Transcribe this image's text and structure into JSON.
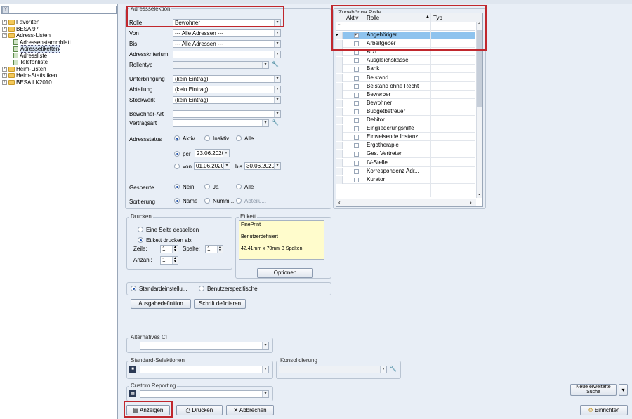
{
  "tree": {
    "filter_value": "",
    "items": [
      {
        "label": "Favoriten",
        "level": 0,
        "type": "folder",
        "expanded": false
      },
      {
        "label": "BESA 97",
        "level": 0,
        "type": "folder",
        "expanded": false
      },
      {
        "label": "Adress-Listen",
        "level": 0,
        "type": "folder",
        "expanded": true
      },
      {
        "label": "Adressenstammblatt",
        "level": 1,
        "type": "doc"
      },
      {
        "label": "Adressetiketten",
        "level": 1,
        "type": "doc",
        "selected": true
      },
      {
        "label": "Adressliste",
        "level": 1,
        "type": "doc"
      },
      {
        "label": "Telefonliste",
        "level": 1,
        "type": "doc"
      },
      {
        "label": "Heim-Listen",
        "level": 0,
        "type": "folder",
        "expanded": false
      },
      {
        "label": "Heim-Statistiken",
        "level": 0,
        "type": "folder",
        "expanded": false
      },
      {
        "label": "BESA LK2010",
        "level": 0,
        "type": "folder",
        "expanded": false
      }
    ]
  },
  "adressselektion": {
    "title": "Adressselektion",
    "rolle_label": "Rolle",
    "rolle_value": "Bewohner",
    "von_label": "Von",
    "von_value": "--- Alle Adressen ---",
    "bis_label": "Bis",
    "bis_value": "--- Alle Adressen ---",
    "kriterium_label": "Adresskriterium",
    "kriterium_value": "",
    "rollentyp_label": "Rollentyp",
    "rollentyp_value": "",
    "unterbringung_label": "Unterbringung",
    "unterbringung_value": "(kein Eintrag)",
    "abteilung_label": "Abteilung",
    "abteilung_value": "(kein Eintrag)",
    "stockwerk_label": "Stockwerk",
    "stockwerk_value": "(kein Eintrag)",
    "bewohnerart_label": "Bewohner-Art",
    "bewohnerart_value": "",
    "vertragsart_label": "Vertragsart",
    "vertragsart_value": "",
    "status_label": "Adressstatus",
    "status_aktiv": "Aktiv",
    "status_inaktiv": "Inaktiv",
    "status_alle": "Alle",
    "per_label": "per",
    "per_date": "23.06.2020",
    "von2_label": "von",
    "von2_date": "01.06.2020",
    "bis2_label": "bis",
    "bis2_date": "30.06.2020",
    "gesperrte_label": "Gesperrte",
    "gesperrte_nein": "Nein",
    "gesperrte_ja": "Ja",
    "gesperrte_alle": "Alle",
    "sortierung_label": "Sortierung",
    "sort_name": "Name",
    "sort_numm": "Numm...",
    "sort_abteilu": "Abteilu..."
  },
  "rollen": {
    "title": "Zugehörige Rolle",
    "col_aktiv": "Aktiv",
    "col_rolle": "Rolle",
    "col_typ": "Typ",
    "rows": [
      {
        "label": "Angehöriger",
        "checked": true,
        "selected": true
      },
      {
        "label": "Arbeitgeber",
        "checked": false
      },
      {
        "label": "Arzt",
        "checked": false
      },
      {
        "label": "Ausgleichskasse",
        "checked": false
      },
      {
        "label": "Bank",
        "checked": false
      },
      {
        "label": "Beistand",
        "checked": false
      },
      {
        "label": "Beistand ohne Recht",
        "checked": false
      },
      {
        "label": "Bewerber",
        "checked": false
      },
      {
        "label": "Bewohner",
        "checked": false
      },
      {
        "label": "Budgetbetreuer",
        "checked": false
      },
      {
        "label": "Debitor",
        "checked": false
      },
      {
        "label": "Eingliederungshilfe",
        "checked": false
      },
      {
        "label": "Einweisende Instanz",
        "checked": false
      },
      {
        "label": "Ergotherapie",
        "checked": false
      },
      {
        "label": "Ges. Vertreter",
        "checked": false
      },
      {
        "label": "IV-Stelle",
        "checked": false
      },
      {
        "label": "Korrespondenz Adr...",
        "checked": false
      },
      {
        "label": "Kurator",
        "checked": false
      }
    ]
  },
  "drucken": {
    "title": "Drucken",
    "eine_seite": "Eine Seite desselben",
    "etikett_ab": "Etikett drucken ab:",
    "zeile_label": "Zeile:",
    "zeile_value": "1",
    "spalte_label": "Spalte:",
    "spalte_value": "1",
    "anzahl_label": "Anzahl:",
    "anzahl_value": "1"
  },
  "etikett": {
    "title": "Etikett",
    "line1": "FinePrint",
    "line2": "Benutzerdefiniert",
    "line3": "42.41mm x 70mm  3 Spalten",
    "optionen": "Optionen"
  },
  "format": {
    "standard": "Standardeinstellu...",
    "benutzer": "Benutzerspezifische",
    "ausgabe_btn": "Ausgabedefinition",
    "schrift_btn": "Schrift definieren"
  },
  "alt_ci": {
    "title": "Alternatives CI",
    "value": ""
  },
  "std_sel": {
    "title": "Standard-Selektionen",
    "value": ""
  },
  "konsolidierung": {
    "title": "Konsolidierung",
    "value": ""
  },
  "custom": {
    "title": "Custom Reporting",
    "value": ""
  },
  "buttons": {
    "anzeigen": "Anzeigen",
    "drucken": "Drucken",
    "abbrechen": "Abbrechen",
    "neue_suche": "Neue erweiterte Suche",
    "einrichten": "Einrichten"
  }
}
